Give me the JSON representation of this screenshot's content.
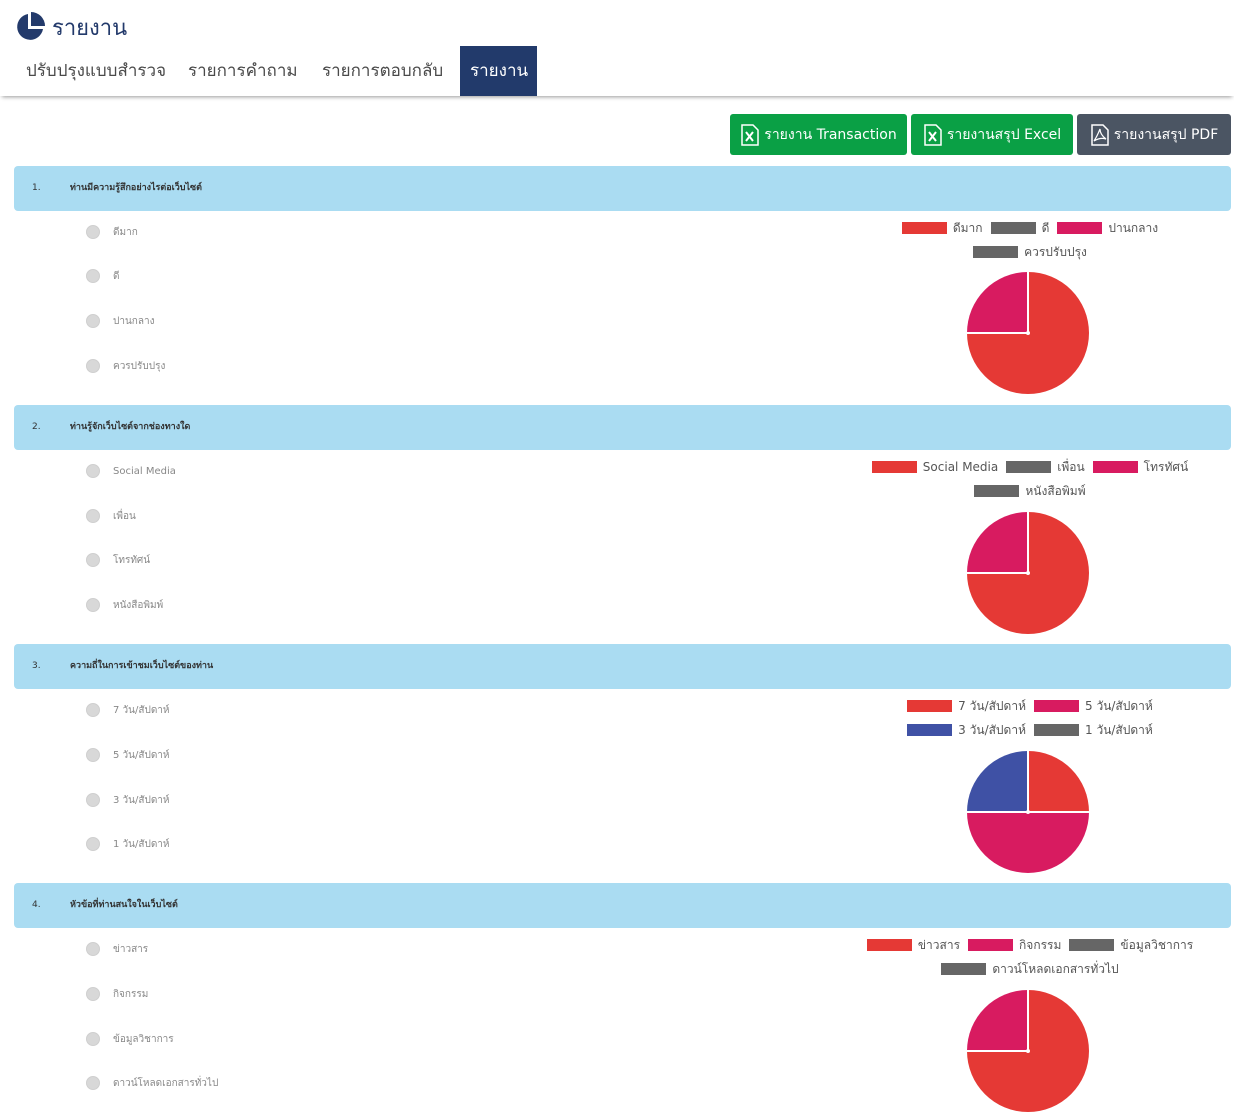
{
  "header": {
    "title": "รายงาน",
    "icon": "pie-chart-icon"
  },
  "nav": {
    "tabs": [
      {
        "label": "ปรับปรุงแบบสำรวจ",
        "active": false
      },
      {
        "label": "รายการคำถาม",
        "active": false
      },
      {
        "label": "รายการตอบกลับ",
        "active": false
      },
      {
        "label": "รายงาน",
        "active": true
      }
    ]
  },
  "buttons": {
    "transaction": {
      "label": "รายงาน Transaction",
      "icon": "excel-file-icon"
    },
    "excel": {
      "label": "รายงานสรุป Excel",
      "icon": "excel-file-icon"
    },
    "pdf": {
      "label": "รายงานสรุป PDF",
      "icon": "pdf-file-icon"
    }
  },
  "colors": {
    "red": "#e53935",
    "pink": "#d81b60",
    "gray": "#666666",
    "blue": "#3f51a5",
    "green": "#0aa045",
    "qbar": "#aadcf2",
    "nav_active": "#223a6b"
  },
  "questions": [
    {
      "number": "1.",
      "text": "ท่านมีความรู้สึกอย่างไรต่อเว็บไซต์",
      "options": [
        "ดีมาก",
        "ดี",
        "ปานกลาง",
        "ควรปรับปรุง"
      ],
      "legend_rows": [
        [
          {
            "label": "ดีมาก",
            "color": "#e53935"
          },
          {
            "label": "ดี",
            "color": "#666666"
          },
          {
            "label": "ปานกลาง",
            "color": "#d81b60"
          }
        ],
        [
          {
            "label": "ควรปรับปรุง",
            "color": "#666666"
          }
        ]
      ]
    },
    {
      "number": "2.",
      "text": "ท่านรู้จักเว็บไซต์จากช่องทางใด",
      "options": [
        "Social Media",
        "เพื่อน",
        "โทรทัศน์",
        "หนังสือพิมพ์"
      ],
      "legend_rows": [
        [
          {
            "label": "Social Media",
            "color": "#e53935"
          },
          {
            "label": "เพื่อน",
            "color": "#666666"
          },
          {
            "label": "โทรทัศน์",
            "color": "#d81b60"
          }
        ],
        [
          {
            "label": "หนังสือพิมพ์",
            "color": "#666666"
          }
        ]
      ]
    },
    {
      "number": "3.",
      "text": "ความถี่ในการเข้าชมเว็บไซต์ของท่าน",
      "options": [
        "7 วัน/สัปดาห์",
        "5 วัน/สัปดาห์",
        "3 วัน/สัปดาห์",
        "1 วัน/สัปดาห์"
      ],
      "legend_rows": [
        [
          {
            "label": "7 วัน/สัปดาห์",
            "color": "#e53935"
          },
          {
            "label": "5 วัน/สัปดาห์",
            "color": "#d81b60"
          }
        ],
        [
          {
            "label": "3 วัน/สัปดาห์",
            "color": "#3f51a5"
          },
          {
            "label": "1 วัน/สัปดาห์",
            "color": "#666666"
          }
        ]
      ]
    },
    {
      "number": "4.",
      "text": "หัวข้อที่ท่านสนใจในเว็บไซต์",
      "options": [
        "ข่าวสาร",
        "กิจกรรม",
        "ข้อมูลวิชาการ",
        "ดาวน์โหลดเอกสารทั่วไป"
      ],
      "legend_rows": [
        [
          {
            "label": "ข่าวสาร",
            "color": "#e53935"
          },
          {
            "label": "กิจกรรม",
            "color": "#d81b60"
          },
          {
            "label": "ข้อมูลวิชาการ",
            "color": "#666666"
          }
        ],
        [
          {
            "label": "ดาวน์โหลดเอกสารทั่วไป",
            "color": "#666666"
          }
        ]
      ]
    }
  ],
  "chart_data": [
    {
      "type": "pie",
      "categories": [
        "ดีมาก",
        "ดี",
        "ปานกลาง",
        "ควรปรับปรุง"
      ],
      "values": [
        3,
        0,
        1,
        0
      ],
      "colors": [
        "#e53935",
        "#666666",
        "#d81b60",
        "#666666"
      ],
      "legend": "top"
    },
    {
      "type": "pie",
      "categories": [
        "Social Media",
        "เพื่อน",
        "โทรทัศน์",
        "หนังสือพิมพ์"
      ],
      "values": [
        3,
        0,
        1,
        0
      ],
      "colors": [
        "#e53935",
        "#666666",
        "#d81b60",
        "#666666"
      ],
      "legend": "top"
    },
    {
      "type": "pie",
      "categories": [
        "7 วัน/สัปดาห์",
        "5 วัน/สัปดาห์",
        "3 วัน/สัปดาห์",
        "1 วัน/สัปดาห์"
      ],
      "values": [
        1,
        2,
        1,
        0
      ],
      "colors": [
        "#e53935",
        "#d81b60",
        "#3f51a5",
        "#666666"
      ],
      "legend": "top"
    },
    {
      "type": "pie",
      "categories": [
        "ข่าวสาร",
        "กิจกรรม",
        "ข้อมูลวิชาการ",
        "ดาวน์โหลดเอกสารทั่วไป"
      ],
      "values": [
        3,
        1,
        0,
        0
      ],
      "colors": [
        "#e53935",
        "#d81b60",
        "#666666",
        "#666666"
      ],
      "legend": "top"
    }
  ]
}
